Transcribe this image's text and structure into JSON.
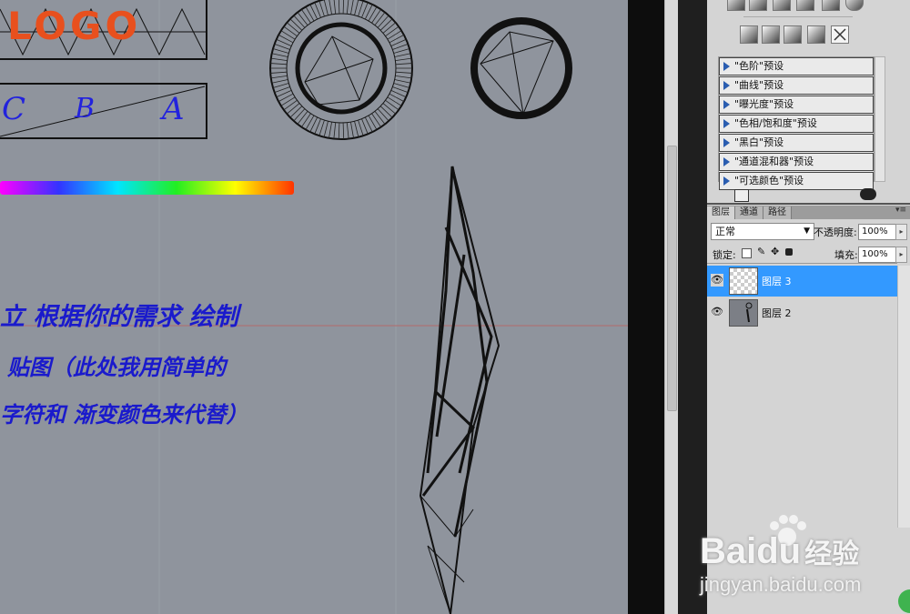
{
  "canvas": {
    "logo_text": "LOGO",
    "letters": [
      "C",
      "B",
      "A"
    ],
    "annotation_lines": [
      "立 根据你的需求 绘制",
      "贴图（此处我用简单的",
      "字符和 渐变颜色来代替）"
    ]
  },
  "adjustments_panel": {
    "presets": [
      "\"色阶\"预设",
      "\"曲线\"预设",
      "\"曝光度\"预设",
      "\"色相/饱和度\"预设",
      "\"黑白\"预设",
      "\"通道混和器\"预设",
      "\"可选颜色\"预设"
    ]
  },
  "layers_panel": {
    "tabs": [
      "图层",
      "通道",
      "路径"
    ],
    "blend_mode": "正常",
    "opacity_label": "不透明度:",
    "opacity_value": "100%",
    "lock_label": "锁定:",
    "fill_label": "填充:",
    "fill_value": "100%",
    "layers": [
      {
        "name": "图层 3",
        "selected": true
      },
      {
        "name": "图层 2",
        "selected": false
      }
    ]
  },
  "watermark": {
    "brand": "Bai",
    "brand2": "du",
    "cn": "经验",
    "url": "jingyan.baidu.com"
  },
  "colors": {
    "canvas_bg": "#8f949d",
    "selection": "#3399ff",
    "annotation_ink": "#1a1acc",
    "logo_orange": "#e8501e"
  }
}
